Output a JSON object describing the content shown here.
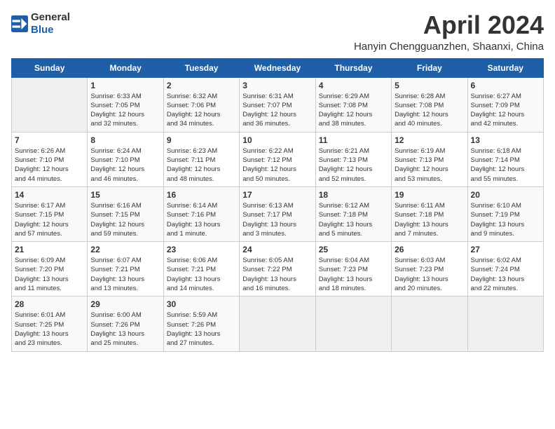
{
  "header": {
    "logo_general": "General",
    "logo_blue": "Blue",
    "month_title": "April 2024",
    "location": "Hanyin Chengguanzhen, Shaanxi, China"
  },
  "days_of_week": [
    "Sunday",
    "Monday",
    "Tuesday",
    "Wednesday",
    "Thursday",
    "Friday",
    "Saturday"
  ],
  "weeks": [
    [
      {
        "day": "",
        "empty": true
      },
      {
        "day": "1",
        "sunrise": "6:33 AM",
        "sunset": "7:05 PM",
        "daylight": "12 hours and 32 minutes."
      },
      {
        "day": "2",
        "sunrise": "6:32 AM",
        "sunset": "7:06 PM",
        "daylight": "12 hours and 34 minutes."
      },
      {
        "day": "3",
        "sunrise": "6:31 AM",
        "sunset": "7:07 PM",
        "daylight": "12 hours and 36 minutes."
      },
      {
        "day": "4",
        "sunrise": "6:29 AM",
        "sunset": "7:08 PM",
        "daylight": "12 hours and 38 minutes."
      },
      {
        "day": "5",
        "sunrise": "6:28 AM",
        "sunset": "7:08 PM",
        "daylight": "12 hours and 40 minutes."
      },
      {
        "day": "6",
        "sunrise": "6:27 AM",
        "sunset": "7:09 PM",
        "daylight": "12 hours and 42 minutes."
      }
    ],
    [
      {
        "day": "7",
        "sunrise": "6:26 AM",
        "sunset": "7:10 PM",
        "daylight": "12 hours and 44 minutes."
      },
      {
        "day": "8",
        "sunrise": "6:24 AM",
        "sunset": "7:10 PM",
        "daylight": "12 hours and 46 minutes."
      },
      {
        "day": "9",
        "sunrise": "6:23 AM",
        "sunset": "7:11 PM",
        "daylight": "12 hours and 48 minutes."
      },
      {
        "day": "10",
        "sunrise": "6:22 AM",
        "sunset": "7:12 PM",
        "daylight": "12 hours and 50 minutes."
      },
      {
        "day": "11",
        "sunrise": "6:21 AM",
        "sunset": "7:13 PM",
        "daylight": "12 hours and 52 minutes."
      },
      {
        "day": "12",
        "sunrise": "6:19 AM",
        "sunset": "7:13 PM",
        "daylight": "12 hours and 53 minutes."
      },
      {
        "day": "13",
        "sunrise": "6:18 AM",
        "sunset": "7:14 PM",
        "daylight": "12 hours and 55 minutes."
      }
    ],
    [
      {
        "day": "14",
        "sunrise": "6:17 AM",
        "sunset": "7:15 PM",
        "daylight": "12 hours and 57 minutes."
      },
      {
        "day": "15",
        "sunrise": "6:16 AM",
        "sunset": "7:15 PM",
        "daylight": "12 hours and 59 minutes."
      },
      {
        "day": "16",
        "sunrise": "6:14 AM",
        "sunset": "7:16 PM",
        "daylight": "13 hours and 1 minute."
      },
      {
        "day": "17",
        "sunrise": "6:13 AM",
        "sunset": "7:17 PM",
        "daylight": "13 hours and 3 minutes."
      },
      {
        "day": "18",
        "sunrise": "6:12 AM",
        "sunset": "7:18 PM",
        "daylight": "13 hours and 5 minutes."
      },
      {
        "day": "19",
        "sunrise": "6:11 AM",
        "sunset": "7:18 PM",
        "daylight": "13 hours and 7 minutes."
      },
      {
        "day": "20",
        "sunrise": "6:10 AM",
        "sunset": "7:19 PM",
        "daylight": "13 hours and 9 minutes."
      }
    ],
    [
      {
        "day": "21",
        "sunrise": "6:09 AM",
        "sunset": "7:20 PM",
        "daylight": "13 hours and 11 minutes."
      },
      {
        "day": "22",
        "sunrise": "6:07 AM",
        "sunset": "7:21 PM",
        "daylight": "13 hours and 13 minutes."
      },
      {
        "day": "23",
        "sunrise": "6:06 AM",
        "sunset": "7:21 PM",
        "daylight": "13 hours and 14 minutes."
      },
      {
        "day": "24",
        "sunrise": "6:05 AM",
        "sunset": "7:22 PM",
        "daylight": "13 hours and 16 minutes."
      },
      {
        "day": "25",
        "sunrise": "6:04 AM",
        "sunset": "7:23 PM",
        "daylight": "13 hours and 18 minutes."
      },
      {
        "day": "26",
        "sunrise": "6:03 AM",
        "sunset": "7:23 PM",
        "daylight": "13 hours and 20 minutes."
      },
      {
        "day": "27",
        "sunrise": "6:02 AM",
        "sunset": "7:24 PM",
        "daylight": "13 hours and 22 minutes."
      }
    ],
    [
      {
        "day": "28",
        "sunrise": "6:01 AM",
        "sunset": "7:25 PM",
        "daylight": "13 hours and 23 minutes."
      },
      {
        "day": "29",
        "sunrise": "6:00 AM",
        "sunset": "7:26 PM",
        "daylight": "13 hours and 25 minutes."
      },
      {
        "day": "30",
        "sunrise": "5:59 AM",
        "sunset": "7:26 PM",
        "daylight": "13 hours and 27 minutes."
      },
      {
        "day": "",
        "empty": true
      },
      {
        "day": "",
        "empty": true
      },
      {
        "day": "",
        "empty": true
      },
      {
        "day": "",
        "empty": true
      }
    ]
  ],
  "labels": {
    "sunrise_label": "Sunrise:",
    "sunset_label": "Sunset:",
    "daylight_label": "Daylight:"
  }
}
